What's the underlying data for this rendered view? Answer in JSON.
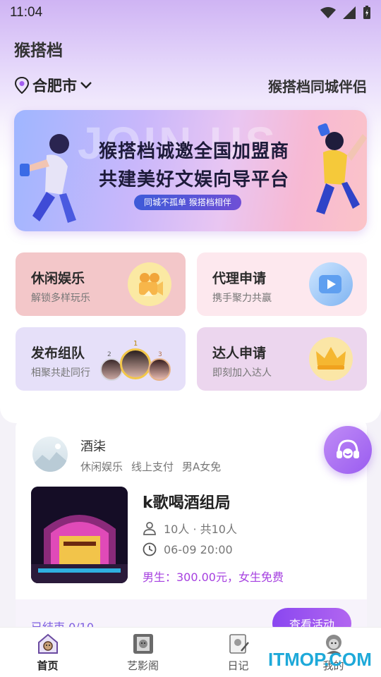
{
  "status_bar": {
    "time": "11:04"
  },
  "header": {
    "app_title": "猴搭档",
    "city": "合肥市",
    "slogan": "猴搭档同城伴侣"
  },
  "banner": {
    "bg_text": "JOIN US",
    "line1": "猴搭档诚邀全国加盟商",
    "line2": "共建美好文娱向导平台",
    "pill": "同城不孤单  猴搭档相伴"
  },
  "cards": [
    {
      "title": "休闲娱乐",
      "subtitle": "解锁多样玩乐",
      "icon": "camera-icon",
      "color": "#f2c6c8"
    },
    {
      "title": "代理申请",
      "subtitle": "携手聚力共赢",
      "icon": "video-play-icon",
      "color": "#fde9ef"
    },
    {
      "title": "发布组队",
      "subtitle": "相聚共赴同行",
      "icon": "avatars-ranking-icon",
      "color": "#e6e0f9"
    },
    {
      "title": "达人申请",
      "subtitle": "即刻加入达人",
      "icon": "crown-icon",
      "color": "#ecd6ee"
    }
  ],
  "ranking_badges": [
    "2",
    "1",
    "3"
  ],
  "event": {
    "host_name": "酒柒",
    "tags": [
      "休闲娱乐",
      "线上支付",
      "男A女免"
    ],
    "title": "k歌喝酒组局",
    "people": "10人 · 共10人",
    "time": "06-09 20:00",
    "price": "男生：300.00元，女生免费",
    "status": "已结束 0/10",
    "button": "查看活动"
  },
  "tabs": [
    {
      "label": "首页",
      "icon": "home-monkey-icon",
      "active": true
    },
    {
      "label": "艺影阁",
      "icon": "film-monkey-icon",
      "active": false
    },
    {
      "label": "日记",
      "icon": "diary-monkey-icon",
      "active": false
    },
    {
      "label": "我的",
      "icon": "profile-monkey-icon",
      "active": false
    }
  ],
  "watermark": "ITMOP.COM",
  "colors": {
    "accent": "#9a5cf0",
    "price": "#a640e0",
    "status": "#7e5ee0"
  }
}
